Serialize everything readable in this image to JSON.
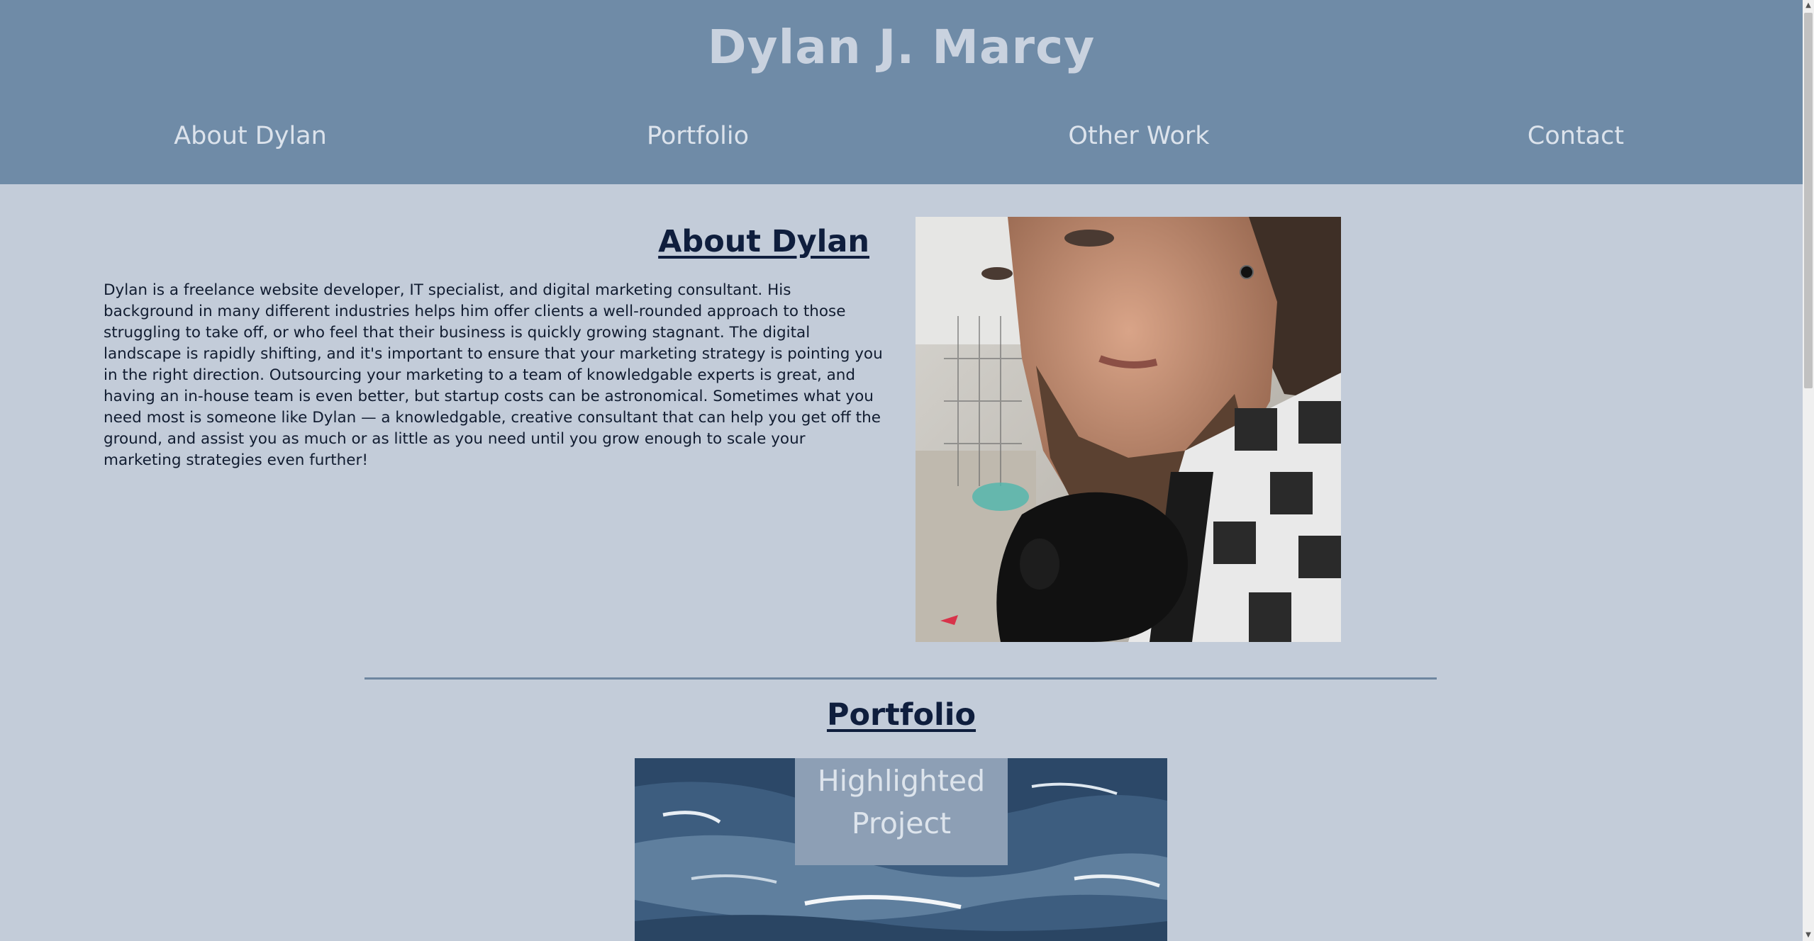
{
  "header": {
    "site_title": "Dylan J. Marcy",
    "nav": [
      {
        "label": "About Dylan"
      },
      {
        "label": "Portfolio"
      },
      {
        "label": "Other Work"
      },
      {
        "label": "Contact"
      }
    ]
  },
  "about": {
    "heading": "About Dylan",
    "body": "Dylan is a freelance website developer, IT specialist, and digital marketing consultant. His background in many different industries helps him offer clients a well-rounded approach to those struggling to take off, or who feel that their business is quickly growing stagnant. The digital landscape is rapidly shifting, and it's important to ensure that your marketing strategy is pointing you in the right direction. Outsourcing your marketing to a team of knowledgable experts is great, and having an in-house team is even better, but startup costs can be astronomical. Sometimes what you need most is someone like Dylan — a knowledgable, creative consultant that can help you get off the ground, and assist you as much or as little as you need until you grow enough to scale your marketing strategies even further!"
  },
  "portfolio": {
    "heading": "Portfolio",
    "highlight_label_line1": "Highlighted",
    "highlight_label_line2": "Project"
  },
  "colors": {
    "header_bg": "#6f8ba7",
    "page_bg": "#c3ccd9",
    "heading_text": "#0f1e3d"
  }
}
